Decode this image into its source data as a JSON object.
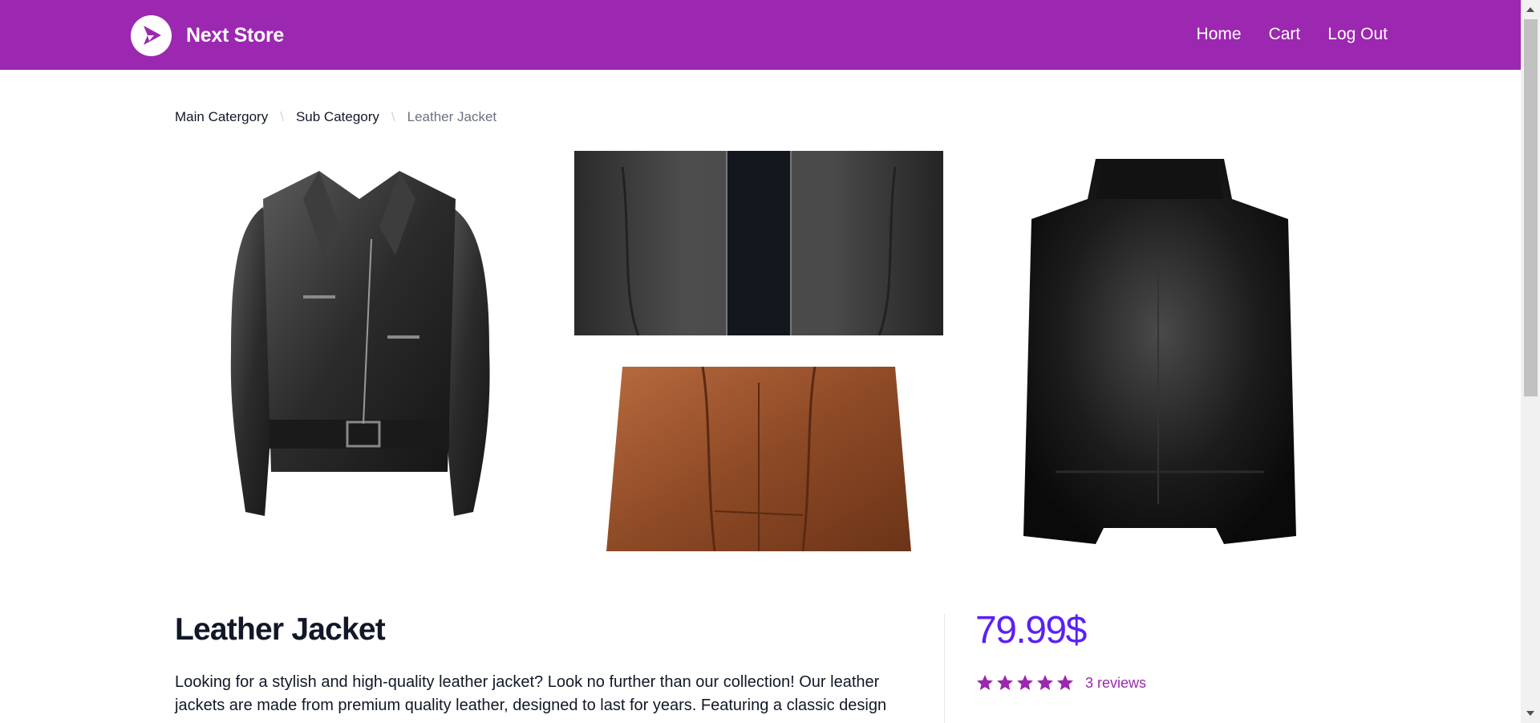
{
  "header": {
    "brand_name": "Next Store",
    "brand_color": "#9c27b0",
    "nav": [
      {
        "label": "Home"
      },
      {
        "label": "Cart"
      },
      {
        "label": "Log Out"
      }
    ]
  },
  "breadcrumb": {
    "items": [
      "Main Catergory",
      "Sub Category"
    ],
    "current": "Leather Jacket"
  },
  "gallery": {
    "images": [
      {
        "alt": "black leather biker jacket front"
      },
      {
        "alt": "black leather jacket close-up"
      },
      {
        "alt": "brown leather jacket"
      },
      {
        "alt": "black leather jacket back"
      }
    ]
  },
  "product": {
    "title": "Leather Jacket",
    "description": "Looking for a stylish and high-quality leather jacket? Look no further than our collection! Our leather jackets are made from premium quality leather, designed to last for years. Featuring a classic design",
    "price": "79.99$",
    "price_color": "#5b21f6",
    "rating": 5,
    "rating_max": 5,
    "reviews_label": "3 reviews"
  }
}
